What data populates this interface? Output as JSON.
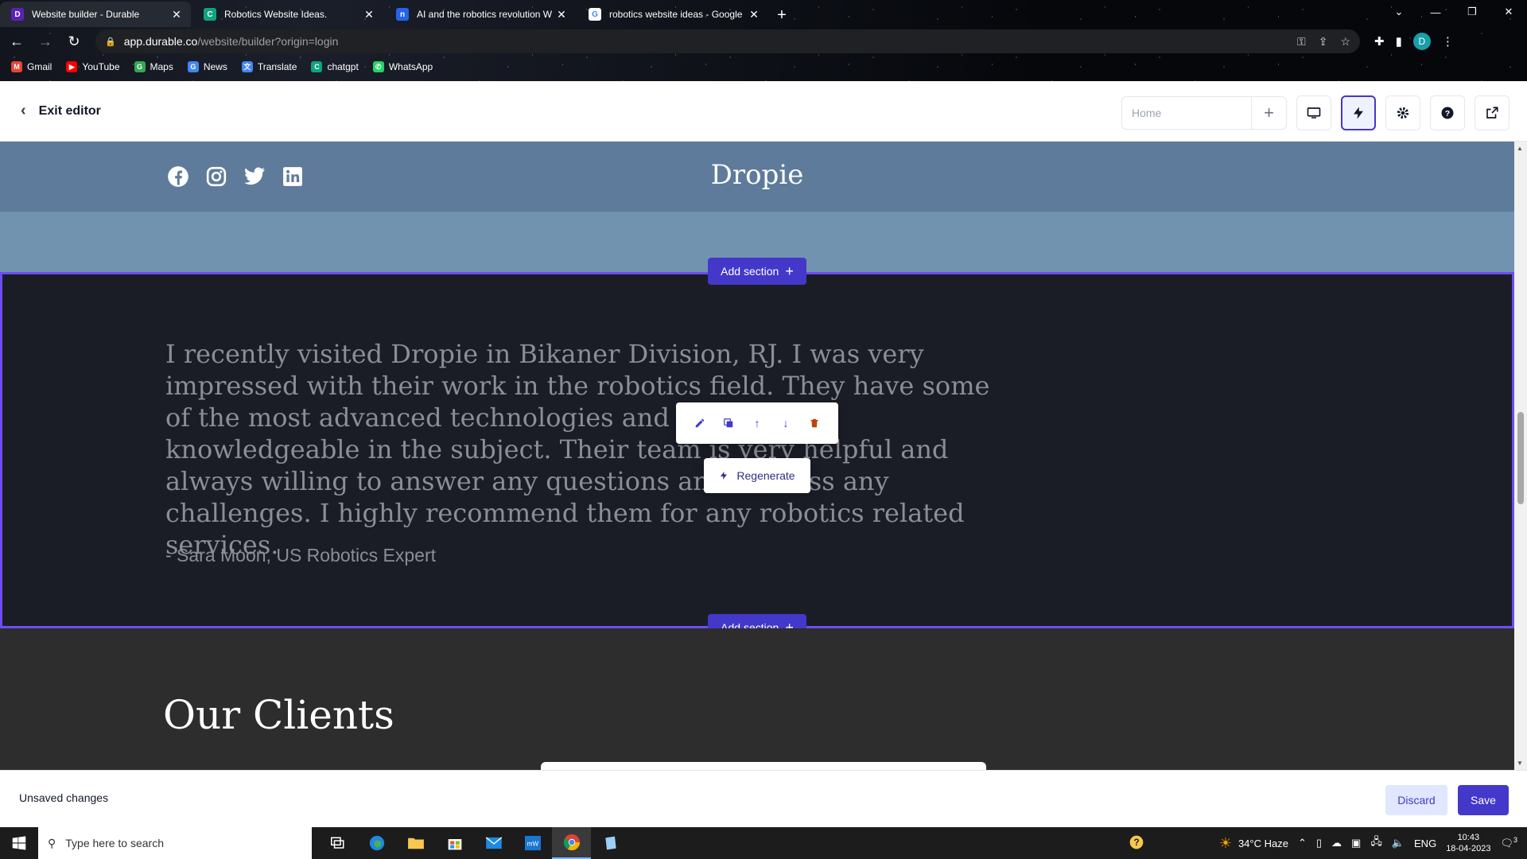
{
  "browser": {
    "tabs": [
      {
        "title": "Website builder - Durable",
        "active": true,
        "favicon_color": "#5b21b6",
        "favicon_glyph": "D"
      },
      {
        "title": "Robotics Website Ideas.",
        "active": false,
        "favicon_color": "#10a37f",
        "favicon_glyph": "C"
      },
      {
        "title": "AI and the robotics revolution W",
        "active": false,
        "favicon_color": "#2563eb",
        "favicon_glyph": "n"
      },
      {
        "title": "robotics website ideas - Google",
        "active": false,
        "favicon_color": "#ffffff",
        "favicon_glyph": "G"
      }
    ],
    "url_host": "app.durable.co",
    "url_path": "/website/builder?origin=login",
    "profile_initial": "D",
    "bookmarks": [
      {
        "label": "Gmail",
        "color": "#ea4335",
        "glyph": "M"
      },
      {
        "label": "YouTube",
        "color": "#ff0000",
        "glyph": "▶"
      },
      {
        "label": "Maps",
        "color": "#34a853",
        "glyph": "G"
      },
      {
        "label": "News",
        "color": "#4285f4",
        "glyph": "G"
      },
      {
        "label": "Translate",
        "color": "#4285f4",
        "glyph": "文"
      },
      {
        "label": "chatgpt",
        "color": "#10a37f",
        "glyph": "C"
      },
      {
        "label": "WhatsApp",
        "color": "#25d366",
        "glyph": "✆"
      }
    ]
  },
  "editor": {
    "exit_label": "Exit editor",
    "page_select_value": "Home"
  },
  "site": {
    "brand": "Dropie",
    "testimonial_quote": "I recently visited Dropie in Bikaner Division, RJ. I was very impressed with their work in the robotics field. They have some of the most advanced technologies and are highly knowledgeable in the subject. Their team is very helpful and always willing to answer any questions and address any challenges. I highly recommend them for any robotics related services.",
    "testimonial_author": "- Sara Moon, US Robotics Expert",
    "clients_heading": "Our Clients"
  },
  "controls": {
    "add_section_label": "Add section",
    "regenerate_label": "Regenerate"
  },
  "savebar": {
    "message": "Unsaved changes",
    "discard_label": "Discard",
    "save_label": "Save"
  },
  "taskbar": {
    "search_placeholder": "Type here to search",
    "weather": "34°C  Haze",
    "language": "ENG",
    "time": "10:43",
    "date": "18-04-2023",
    "notifications": "3"
  },
  "colors": {
    "accent": "#4338ca",
    "selection_border": "#6d4cf6",
    "header_bg": "#5e7b9b",
    "testimonial_bg": "#1a1d26"
  }
}
